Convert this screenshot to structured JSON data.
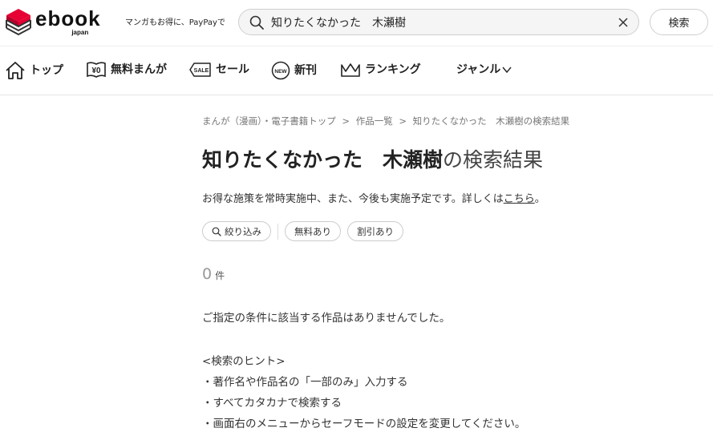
{
  "header": {
    "logo_word": "ebook",
    "logo_sub": "japan",
    "tagline": "マンガもお得に、PayPayで",
    "search_value": "知りたくなかった　木瀬樹",
    "search_button": "検索"
  },
  "nav": {
    "items": [
      {
        "label": "トップ",
        "icon": "home-icon"
      },
      {
        "label": "無料まんが",
        "icon": "free-yen-book-icon"
      },
      {
        "label": "セール",
        "icon": "sale-tag-icon"
      },
      {
        "label": "新刊",
        "icon": "new-badge-icon"
      },
      {
        "label": "ランキング",
        "icon": "crown-icon"
      },
      {
        "label": "ジャンル",
        "icon": "chevron-down-icon"
      }
    ]
  },
  "breadcrumb": {
    "items": [
      "まんが（漫画）・電子書籍トップ",
      "作品一覧",
      "知りたくなかった　木瀬樹の検索結果"
    ],
    "separator": ">"
  },
  "page": {
    "title_query": "知りたくなかった　木瀬樹",
    "title_suffix": "の検索結果",
    "notice_text": "お得な施策を常時実施中、また、今後も実施予定です。詳しくは",
    "notice_link": "こちら",
    "notice_end": "。"
  },
  "filters": {
    "narrow": "絞り込み",
    "free": "無料あり",
    "discount": "割引あり"
  },
  "result": {
    "count": "0",
    "unit": "件",
    "message": "ご指定の条件に該当する作品はありませんでした。"
  },
  "hints": {
    "title": "<検索のヒント>",
    "items": [
      "・著作名や作品名の「一部のみ」入力する",
      "・すべてカタカナで検索する",
      "・画面右のメニューからセーフモードの設定を変更してください。"
    ]
  },
  "colors": {
    "brand_red": "#e60033",
    "text": "#333333"
  }
}
